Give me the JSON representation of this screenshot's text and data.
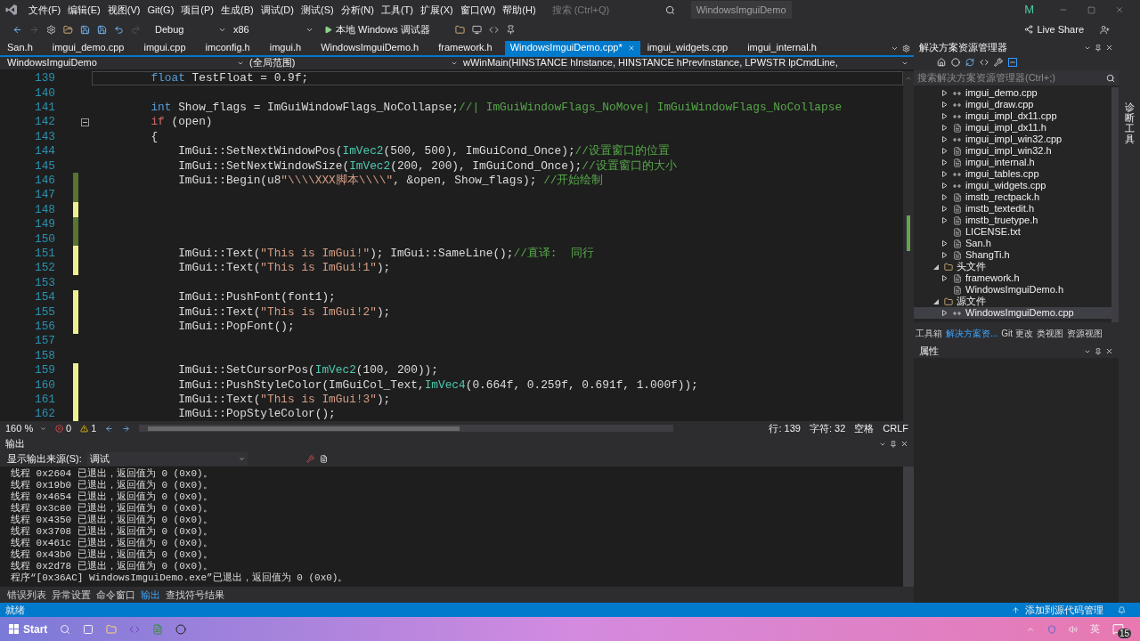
{
  "title_bar": {
    "menus": [
      "文件(F)",
      "编辑(E)",
      "视图(V)",
      "Git(G)",
      "项目(P)",
      "生成(B)",
      "调试(D)",
      "测试(S)",
      "分析(N)",
      "工具(T)",
      "扩展(X)",
      "窗口(W)",
      "帮助(H)"
    ],
    "search": {
      "placeholder": "搜索 (Ctrl+Q)"
    },
    "title": "WindowsImguiDemo",
    "avatar": "M"
  },
  "toolbar": {
    "configuration": "Debug",
    "platform": "x86",
    "run_label": "本地 Windows 调试器",
    "live_share": "Live Share"
  },
  "tabs": [
    {
      "label": "San.h",
      "selected": false
    },
    {
      "label": "imgui_demo.cpp",
      "selected": false
    },
    {
      "label": "imgui.cpp",
      "selected": false
    },
    {
      "label": "imconfig.h",
      "selected": false
    },
    {
      "label": "imgui.h",
      "selected": false
    },
    {
      "label": "WindowsImguiDemo.h",
      "selected": false
    },
    {
      "label": "framework.h",
      "selected": false
    },
    {
      "label": "WindowsImguiDemo.cpp*",
      "selected": true
    },
    {
      "label": "imgui_widgets.cpp",
      "selected": false
    },
    {
      "label": "imgui_internal.h",
      "selected": false
    }
  ],
  "nav_bar": {
    "project": "WindowsImguiDemo",
    "scope": "(全局范围)",
    "member": "wWinMain(HINSTANCE hInstance, HINSTANCE hPrevInstance, LPWSTR lpCmdLine,"
  },
  "code_lines": [
    {
      "number": "139",
      "current": true,
      "tokens": [
        {
          "kind": "keyword",
          "text": "        float"
        },
        {
          "kind": "plain",
          "text": " TestFloat = 0.9f;"
        }
      ]
    },
    {
      "number": "140",
      "current": false
    },
    {
      "number": "141",
      "current": false,
      "tokens": [
        {
          "kind": "keyword",
          "text": "        int"
        },
        {
          "kind": "plain",
          "text": " Show_flags = ImGuiWindowFlags_NoCollapse;"
        },
        {
          "kind": "comment",
          "text": "//| ImGuiWindowFlags_NoMove| ImGuiWindowFlags_NoCollapse"
        }
      ]
    },
    {
      "number": "142",
      "current": false,
      "expanded": true,
      "tokens": [
        {
          "kind": "control",
          "text": "        if"
        },
        {
          "kind": "plain",
          "text": " (open)"
        }
      ]
    },
    {
      "number": "143",
      "current": false,
      "tokens": [
        {
          "kind": "plain",
          "text": "        {"
        }
      ]
    },
    {
      "number": "144",
      "current": false,
      "tokens": [
        {
          "kind": "plain",
          "text": "            ImGui::SetNextWindowPos("
        },
        {
          "kind": "type",
          "text": "ImVec2"
        },
        {
          "kind": "plain",
          "text": "(500, 500), ImGuiCond_Once);"
        },
        {
          "kind": "comment",
          "text": "//设置窗口的位置"
        }
      ]
    },
    {
      "number": "145",
      "current": false,
      "tokens": [
        {
          "kind": "plain",
          "text": "            ImGui::SetNextWindowSize("
        },
        {
          "kind": "type",
          "text": "ImVec2"
        },
        {
          "kind": "plain",
          "text": "(200, 200), ImGuiCond_Once);"
        },
        {
          "kind": "comment",
          "text": "//设置窗口的大小"
        }
      ]
    },
    {
      "number": "146",
      "color": "#577430",
      "current": false,
      "tokens": [
        {
          "kind": "plain",
          "text": "            ImGui::Begin(u8"
        },
        {
          "kind": "string",
          "text": "\"\\\\\\\\XXX脚本\\\\\\\\\""
        },
        {
          "kind": "plain",
          "text": ", &open, Show_flags); "
        },
        {
          "kind": "comment",
          "text": "//开始绘制"
        }
      ]
    },
    {
      "number": "147",
      "color": "#577430",
      "current": false
    },
    {
      "number": "148",
      "color": "#efef91",
      "current": false
    },
    {
      "number": "149",
      "color": "#577430",
      "current": false
    },
    {
      "number": "150",
      "color": "#577430",
      "current": false
    },
    {
      "number": "151",
      "color": "#efef91",
      "current": false,
      "tokens": [
        {
          "kind": "plain",
          "text": "            ImGui::Text("
        },
        {
          "kind": "string",
          "text": "\"This is ImGui!\""
        },
        {
          "kind": "plain",
          "text": "); ImGui::SameLine();"
        },
        {
          "kind": "comment",
          "text": "//直译:  同行"
        }
      ]
    },
    {
      "number": "152",
      "color": "#efef91",
      "current": false,
      "tokens": [
        {
          "kind": "plain",
          "text": "            ImGui::Text("
        },
        {
          "kind": "string",
          "text": "\"This is ImGui!1\""
        },
        {
          "kind": "plain",
          "text": ");"
        }
      ]
    },
    {
      "number": "153",
      "current": false
    },
    {
      "number": "154",
      "color": "#efef91",
      "current": false,
      "tokens": [
        {
          "kind": "plain",
          "text": "            ImGui::PushFont(font1);"
        }
      ]
    },
    {
      "number": "155",
      "color": "#efef91",
      "current": false,
      "tokens": [
        {
          "kind": "plain",
          "text": "            ImGui::Text("
        },
        {
          "kind": "string",
          "text": "\"This is ImGui!2\""
        },
        {
          "kind": "plain",
          "text": ");"
        }
      ]
    },
    {
      "number": "156",
      "color": "#efef91",
      "current": false,
      "tokens": [
        {
          "kind": "plain",
          "text": "            ImGui::PopFont();"
        }
      ]
    },
    {
      "number": "157",
      "current": false
    },
    {
      "number": "158",
      "current": false
    },
    {
      "number": "159",
      "color": "#efef91",
      "current": false,
      "tokens": [
        {
          "kind": "plain",
          "text": "            ImGui::SetCursorPos("
        },
        {
          "kind": "type",
          "text": "ImVec2"
        },
        {
          "kind": "plain",
          "text": "(100, 200));"
        }
      ]
    },
    {
      "number": "160",
      "color": "#efef91",
      "current": false,
      "tokens": [
        {
          "kind": "plain",
          "text": "            ImGui::PushStyleColor(ImGuiCol_Text,"
        },
        {
          "kind": "type",
          "text": "ImVec4"
        },
        {
          "kind": "plain",
          "text": "(0.664f, 0.259f, 0.691f, 1.000f));"
        }
      ]
    },
    {
      "number": "161",
      "color": "#efef91",
      "current": false,
      "tokens": [
        {
          "kind": "plain",
          "text": "            ImGui::Text("
        },
        {
          "kind": "string",
          "text": "\"This is ImGui!3\""
        },
        {
          "kind": "plain",
          "text": ");"
        }
      ]
    },
    {
      "number": "162",
      "color": "#efef91",
      "current": false,
      "tokens": [
        {
          "kind": "plain",
          "text": "            ImGui::PopStyleColor();"
        }
      ]
    }
  ],
  "editor_status": {
    "zoom": "160 %",
    "errors": "0",
    "warnings": "1",
    "line": "行: 139",
    "column": "字符: 32",
    "indent": "空格",
    "line_ending": "CRLF"
  },
  "output": {
    "title": "输出",
    "source_label": "显示输出来源(S):",
    "source": "调试",
    "lines": [
      "线程 0x2604 已退出，返回值为 0 (0x0)。",
      "线程 0x19b0 已退出，返回值为 0 (0x0)。",
      "线程 0x4654 已退出，返回值为 0 (0x0)。",
      "线程 0x3c80 已退出，返回值为 0 (0x0)。",
      "线程 0x4350 已退出，返回值为 0 (0x0)。",
      "线程 0x3708 已退出，返回值为 0 (0x0)。",
      "线程 0x461c 已退出，返回值为 0 (0x0)。",
      "线程 0x43b0 已退出，返回值为 0 (0x0)。",
      "线程 0x2d78 已退出，返回值为 0 (0x0)。",
      "程序“[0x36AC] WindowsImguiDemo.exe”已退出，返回值为 0 (0x0)。"
    ]
  },
  "bottom_tabs": [
    {
      "label": "错误列表",
      "selected": false
    },
    {
      "label": "异常设置",
      "selected": false
    },
    {
      "label": "命令窗口",
      "selected": false
    },
    {
      "label": "输出",
      "selected": true
    },
    {
      "label": "查找符号结果",
      "selected": false
    }
  ],
  "solution_explorer": {
    "title": "解决方案资源管理器",
    "search": {
      "placeholder": "搜索解决方案资源管理器(Ctrl+;)"
    },
    "items_continued": [
      {
        "label": "imgui_demo.cpp",
        "kind": "cpp",
        "expanded": false,
        "selected": false
      },
      {
        "label": "imgui_draw.cpp",
        "kind": "cpp",
        "expanded": false,
        "selected": false
      },
      {
        "label": "imgui_impl_dx11.cpp",
        "kind": "cpp",
        "expanded": false,
        "selected": false
      },
      {
        "label": "imgui_impl_dx11.h",
        "kind": "header",
        "expanded": false,
        "selected": false
      },
      {
        "label": "imgui_impl_win32.cpp",
        "kind": "cpp",
        "expanded": false,
        "selected": false
      },
      {
        "label": "imgui_impl_win32.h",
        "kind": "header",
        "expanded": false,
        "selected": false
      },
      {
        "label": "imgui_internal.h",
        "kind": "header",
        "expanded": false,
        "selected": false
      },
      {
        "label": "imgui_tables.cpp",
        "kind": "cpp",
        "expanded": false,
        "selected": false
      },
      {
        "label": "imgui_widgets.cpp",
        "kind": "cpp",
        "expanded": false,
        "selected": false
      },
      {
        "label": "imstb_rectpack.h",
        "kind": "header",
        "expanded": false,
        "selected": false
      },
      {
        "label": "imstb_textedit.h",
        "kind": "header",
        "expanded": false,
        "selected": false
      },
      {
        "label": "imstb_truetype.h",
        "kind": "header",
        "expanded": false,
        "selected": false
      },
      {
        "label": "LICENSE.txt",
        "kind": "text",
        "selected": false
      },
      {
        "label": "San.h",
        "kind": "header",
        "expanded": false,
        "selected": false
      },
      {
        "label": "ShangTi.h",
        "kind": "header",
        "expanded": false,
        "selected": false
      }
    ],
    "folders": [
      {
        "label": "头文件",
        "expanded": true,
        "children": [
          {
            "label": "framework.h",
            "kind": "header",
            "expanded": false,
            "selected": false
          },
          {
            "label": "WindowsImguiDemo.h",
            "kind": "header",
            "selected": false
          }
        ]
      },
      {
        "label": "源文件",
        "expanded": true,
        "children": [
          {
            "label": "WindowsImguiDemo.cpp",
            "kind": "cpp",
            "expanded": false,
            "selected": true
          }
        ]
      }
    ],
    "tabs": [
      {
        "label": "工具箱",
        "selected": false
      },
      {
        "label": "解决方案资...",
        "selected": true
      },
      {
        "label": "Git 更改",
        "selected": false
      },
      {
        "label": "类视图",
        "selected": false
      },
      {
        "label": "资源视图",
        "selected": false
      }
    ]
  },
  "properties": {
    "title": "属性"
  },
  "side_strip": {
    "label": "诊断工具"
  },
  "status_bar": {
    "state": "就绪",
    "source_control": "添加到源代码管理"
  },
  "taskbar": {
    "start": "Start",
    "input_method": "英",
    "notifications": "15"
  }
}
